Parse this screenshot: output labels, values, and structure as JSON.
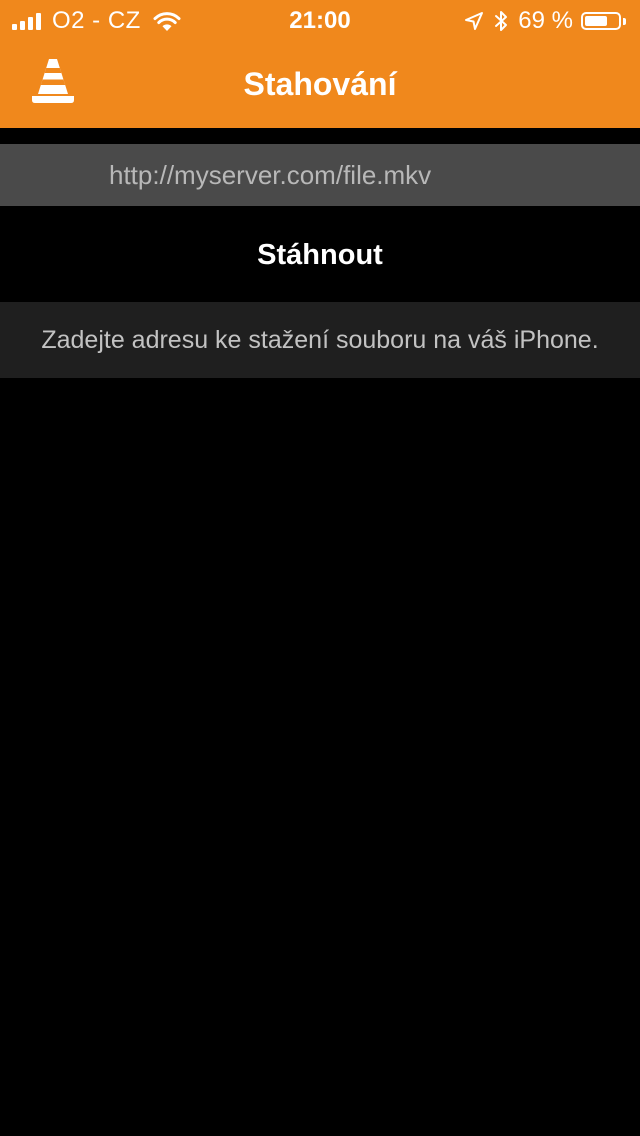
{
  "status_bar": {
    "carrier": "O2 - CZ",
    "time": "21:00",
    "battery_percent": "69 %",
    "battery_level": 0.69,
    "icons": [
      "signal-icon",
      "wifi-icon",
      "location-arrow-icon",
      "bluetooth-icon",
      "battery-icon"
    ]
  },
  "nav": {
    "title": "Stahování",
    "logo_icon": "vlc-cone-icon"
  },
  "download": {
    "url_placeholder": "http://myserver.com/file.mkv",
    "url_value": "",
    "button_label": "Stáhnout",
    "help_text": "Zadejte adresu ke stažení souboru na váš iPhone."
  },
  "colors": {
    "accent": "#F0881C",
    "background": "#000000",
    "input_background": "#4A4A4A",
    "help_background": "#1F1F1F"
  }
}
